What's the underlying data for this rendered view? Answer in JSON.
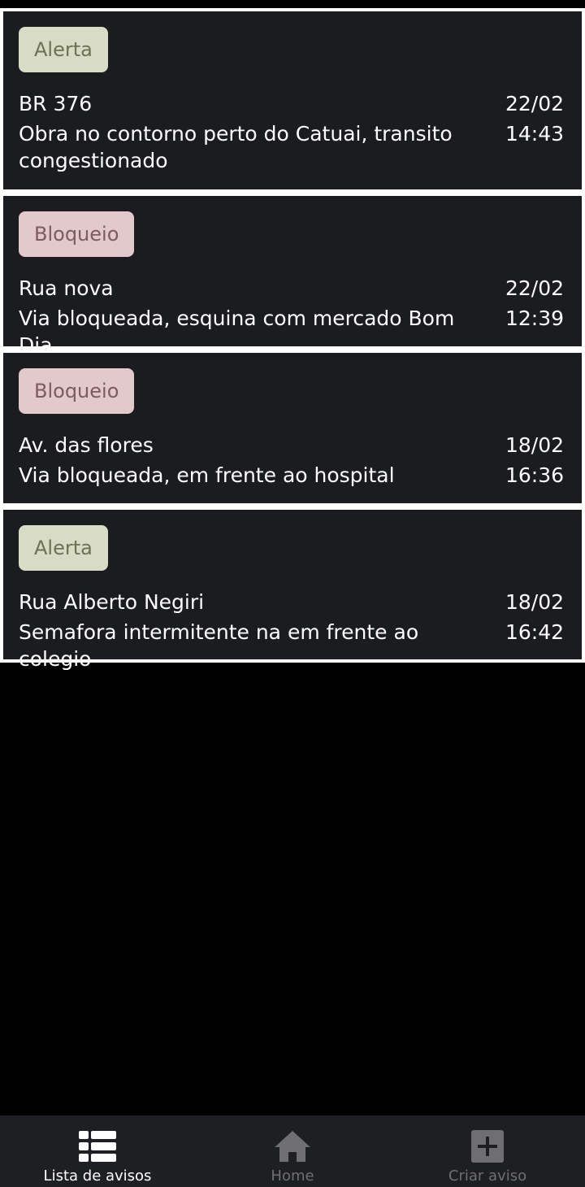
{
  "notices": [
    {
      "type": "Alerta",
      "title": "BR 376",
      "description": "Obra no contorno perto do Catuai, transito congestionado",
      "date": "22/02",
      "time": "14:43"
    },
    {
      "type": "Bloqueio",
      "title": "Rua nova",
      "description": "Via bloqueada, esquina com mercado Bom Dia",
      "date": "22/02",
      "time": "12:39"
    },
    {
      "type": "Bloqueio",
      "title": "Av. das flores",
      "description": "Via bloqueada, em frente ao hospital",
      "date": "18/02",
      "time": "16:36"
    },
    {
      "type": "Alerta",
      "title": "Rua Alberto Negiri",
      "description": "Semafora intermitente na em frente ao colegio",
      "date": "18/02",
      "time": "16:42"
    }
  ],
  "bottom_nav": {
    "items": [
      {
        "label": "Lista de avisos",
        "icon": "list-icon",
        "active": true
      },
      {
        "label": "Home",
        "icon": "home-icon",
        "active": false
      },
      {
        "label": "Criar aviso",
        "icon": "add-box-icon",
        "active": false
      }
    ]
  },
  "colors": {
    "card_bg": "#1b1c1f",
    "alerta_chip_bg": "#d8dcc4",
    "bloqueio_chip_bg": "#e1c9cc",
    "nav_bg": "#1e1f22",
    "nav_active": "#ffffff",
    "nav_inactive": "#6f6f72"
  }
}
